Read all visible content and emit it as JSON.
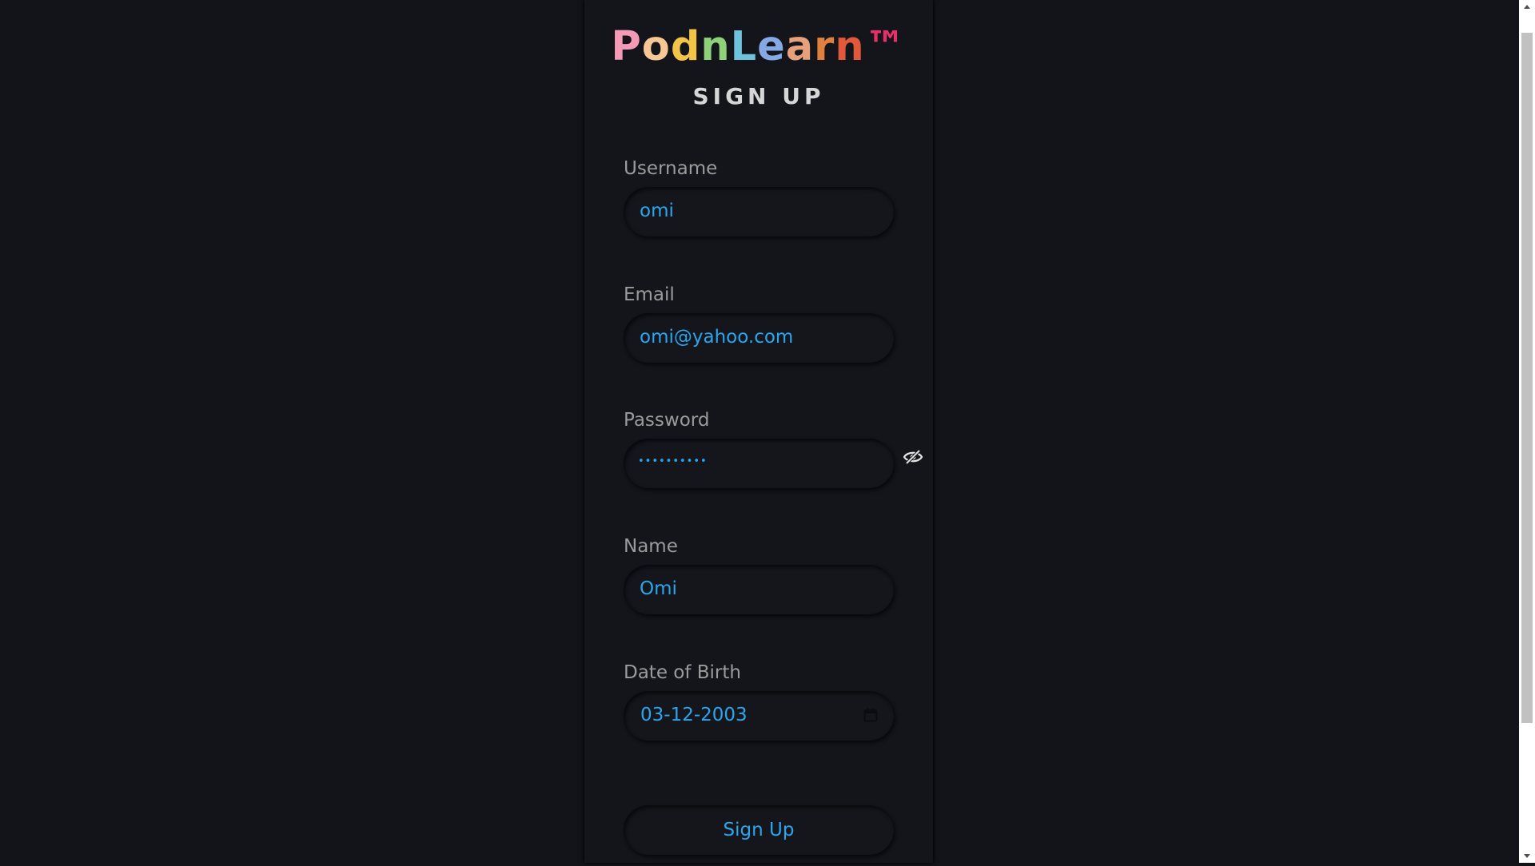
{
  "brand": {
    "name_parts": [
      "P",
      "o",
      "d",
      "n",
      "L",
      "e",
      "a",
      "r",
      "n",
      "™"
    ],
    "colors": [
      "#f59ab6",
      "#f8c796",
      "#f2c447",
      "#8ed17a",
      "#6fc2dc",
      "#86a9e6",
      "#e7a07c",
      "#e0803f",
      "#e2583a",
      "#e53167"
    ]
  },
  "page": {
    "subtitle": "SIGN UP"
  },
  "form": {
    "username": {
      "label": "Username",
      "value": "omi"
    },
    "email": {
      "label": "Email",
      "value": "omi@yahoo.com"
    },
    "password": {
      "label": "Password",
      "masked": "••••••••••"
    },
    "name": {
      "label": "Name",
      "value": "Omi"
    },
    "dob": {
      "label": "Date of Birth",
      "value": "03-12-2003"
    },
    "submit_label": "Sign Up"
  },
  "icons": {
    "password_toggle": "eye-slash-icon",
    "date_picker": "calendar-icon"
  },
  "theme": {
    "background": "#13141a",
    "accent": "#2aa6ee",
    "label": "#9b9b9b"
  }
}
